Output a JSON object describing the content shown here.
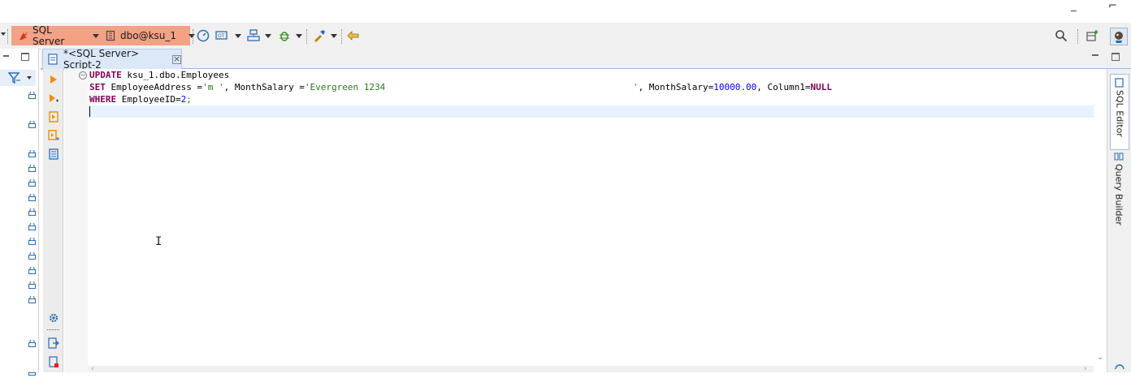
{
  "toolbar": {
    "datasource_label": "SQL Server",
    "connection_label": "dbo@ksu_1",
    "icons": [
      "commit-mode-icon",
      "transaction-icon",
      "schema-compare-icon",
      "debug-icon",
      "tools-icon",
      "back-icon",
      "search-icon",
      "perspective-icon",
      "dbeaver-icon"
    ]
  },
  "editor": {
    "tab_label": "*<SQL Server> Script-2",
    "code": {
      "l1_kw": "UPDATE",
      "l1_rest": " ksu_1.dbo.Employees",
      "l2_kw": "SET",
      "l2_a": " EmployeeAddress =",
      "l2_s1": "'m '",
      "l2_b": ", MonthSalary =",
      "l2_s2": "'Evergreen 1234                                              '",
      "l2_c": ", MonthSalary=",
      "l2_n1": "10000.00",
      "l2_d": ", Column1=",
      "l2_null": "NULL",
      "l3_kw": "WHERE",
      "l3_a": " EmployeeID=",
      "l3_n": "2",
      "l3_end": ";"
    }
  },
  "side_tabs": {
    "sql_editor": "SQL Editor",
    "query_builder": "Query Builder"
  },
  "colors": {
    "connection_bg": "#f4a185",
    "keyword": "#7f0055",
    "string": "#2a7a1a",
    "number": "#0000ff",
    "current_line": "#e8f2fe"
  }
}
